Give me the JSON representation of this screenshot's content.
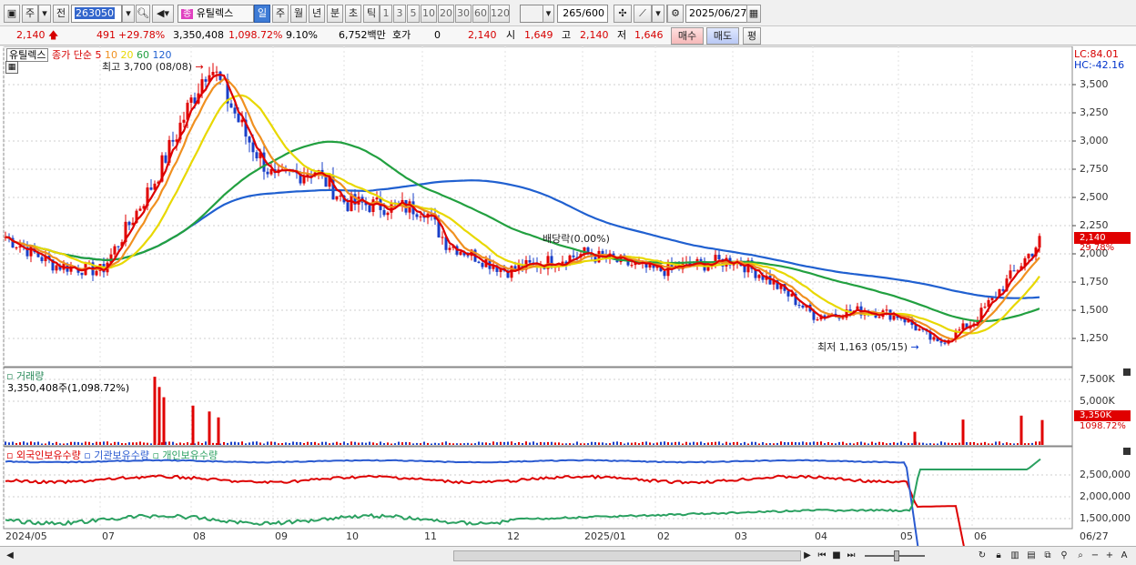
{
  "toolbar": {
    "market_prefix": "주",
    "prev_label": "전",
    "code": "263050",
    "stock_badge": "종",
    "stock_name": "유틸렉스",
    "periods": [
      "일",
      "주",
      "월",
      "년",
      "분",
      "초",
      "틱"
    ],
    "active_period": "일",
    "intervals": [
      "1",
      "3",
      "5",
      "10",
      "20",
      "30",
      "60",
      "120"
    ],
    "count": "265",
    "count_total": "/600",
    "date": "2025/06/27"
  },
  "quote": {
    "price": "2,140",
    "change": "491",
    "change_pct": "+29.78%",
    "volume": "3,350,408",
    "volume_pct": "1,098.72%",
    "turnover": "9.10%",
    "amount": "6,752백만",
    "hoga_label": "호가",
    "hoga_value": "0",
    "bid_price": "2,140",
    "open_label": "시",
    "open": "1,649",
    "high_label": "고",
    "high": "2,140",
    "low_label": "저",
    "low": "1,646",
    "buy_label": "매수",
    "sell_label": "매도",
    "avg_label": "평"
  },
  "price_panel": {
    "stock_tag": "유틸렉스",
    "ma_label": "종가 단순",
    "ma_periods": [
      {
        "label": "5",
        "color": "#dd0000"
      },
      {
        "label": "10",
        "color": "#f09020"
      },
      {
        "label": "20",
        "color": "#e8d800"
      },
      {
        "label": "60",
        "color": "#22a040"
      },
      {
        "label": "120",
        "color": "#2060d0"
      }
    ],
    "high_annotation": "최고 3,700 (08/08)",
    "low_annotation": "최저 1,163 (05/15)",
    "dividend_annotation": "배당락(0.00%)",
    "lc_label": "LC:84.01",
    "hc_label": "HC:-42.16",
    "y_ticks": [
      "3,500",
      "3,250",
      "3,000",
      "2,750",
      "2,500",
      "2,250",
      "2,000",
      "1,750",
      "1,500",
      "1,250"
    ],
    "current_tag": "2,140",
    "current_pct": "29.78%"
  },
  "volume_panel": {
    "title": "거래량",
    "summary": "3,350,408주(1,098.72%)",
    "y_ticks": [
      "7,500K",
      "5,000K"
    ],
    "current_tag": "3,350K",
    "current_pct": "1098.72%"
  },
  "holdings_panel": {
    "legend": [
      {
        "label": "외국인보유수량",
        "color": "#dd0000"
      },
      {
        "label": "기관보유수량",
        "color": "#2a5ad0"
      },
      {
        "label": "개인보유수량",
        "color": "#2aa060"
      }
    ],
    "y_ticks": [
      "2,500,000",
      "2,000,000",
      "1,500,000"
    ]
  },
  "x_axis": {
    "labels": [
      "2024/05",
      "07",
      "08",
      "09",
      "10",
      "11",
      "12",
      "2025/01",
      "02",
      "03",
      "04",
      "05",
      "06",
      "06/27"
    ]
  },
  "chart_data": {
    "type": "line",
    "price_range": [
      1163,
      3700
    ],
    "high": {
      "value": 3700,
      "date": "08/08"
    },
    "low": {
      "value": 1163,
      "date": "05/15"
    },
    "close_approx": [
      {
        "x": "2024/05",
        "y": 2150
      },
      {
        "x": "06",
        "y": 1900
      },
      {
        "x": "07",
        "y": 1850
      },
      {
        "x": "07/mid",
        "y": 2650
      },
      {
        "x": "08",
        "y": 3700
      },
      {
        "x": "08/mid",
        "y": 3050
      },
      {
        "x": "09",
        "y": 2650
      },
      {
        "x": "09/mid",
        "y": 2750
      },
      {
        "x": "10",
        "y": 2450
      },
      {
        "x": "11",
        "y": 2400
      },
      {
        "x": "11/mid",
        "y": 2100
      },
      {
        "x": "12",
        "y": 1850
      },
      {
        "x": "2025/01",
        "y": 2000
      },
      {
        "x": "02",
        "y": 1850
      },
      {
        "x": "03",
        "y": 1950
      },
      {
        "x": "03/mid",
        "y": 1800
      },
      {
        "x": "04",
        "y": 1450
      },
      {
        "x": "04/mid",
        "y": 1500
      },
      {
        "x": "05",
        "y": 1450
      },
      {
        "x": "05/15",
        "y": 1200
      },
      {
        "x": "06",
        "y": 1400
      },
      {
        "x": "06/27",
        "y": 2140
      }
    ],
    "volume_spikes": [
      {
        "x": "07/mid",
        "value": 7800
      },
      {
        "x": "08",
        "value": 4500
      },
      {
        "x": "05",
        "value": 1500
      },
      {
        "x": "06",
        "value": 2900
      },
      {
        "x": "06/27",
        "value": 3350
      }
    ]
  }
}
